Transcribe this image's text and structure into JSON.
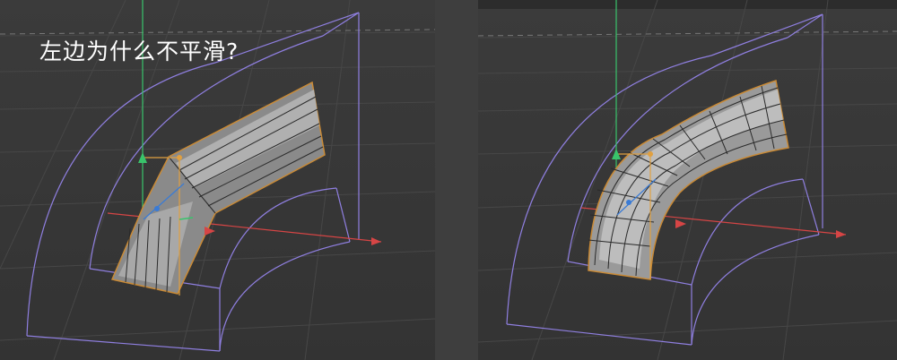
{
  "question_text": "左边为什么不平滑?",
  "colors": {
    "background": "#3a3a3a",
    "grid": "#4a4a4a",
    "bounding_box": "#8f7fe0",
    "axis_x": "#d64545",
    "axis_y": "#39c46b",
    "axis_z": "#3a7bd5",
    "selection": "#e0a040",
    "mesh_edge": "#2a2a2a"
  },
  "viewports": [
    {
      "name": "left-viewport",
      "mesh_style": "angular",
      "icon": "bent-tube-mesh-icon"
    },
    {
      "name": "right-viewport",
      "mesh_style": "smooth",
      "icon": "smooth-bent-tube-mesh-icon"
    }
  ]
}
